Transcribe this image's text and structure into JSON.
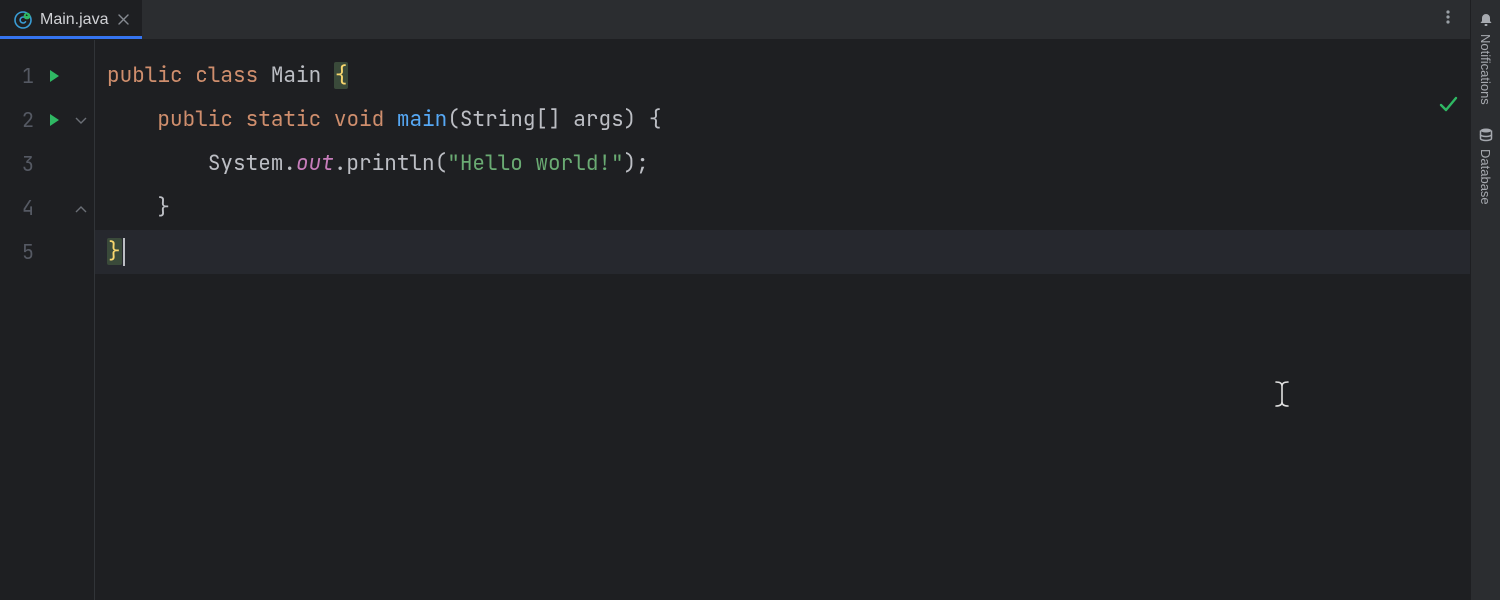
{
  "tab": {
    "filename": "Main.java",
    "active": true
  },
  "rightRail": {
    "notifications": "Notifications",
    "database": "Database"
  },
  "editor": {
    "currentLine": 5,
    "lines": [
      "1",
      "2",
      "3",
      "4",
      "5"
    ],
    "runOnLines": [
      1,
      2
    ],
    "code": {
      "l1": {
        "kw1": "public",
        "kw2": "class",
        "cls": "Main",
        "brace": "{"
      },
      "l2": {
        "kw1": "public",
        "kw2": "static",
        "kw3": "void",
        "method": "main",
        "sig": "(String[] args) {"
      },
      "l3": {
        "sysout": "System.",
        "out": "out",
        "print": ".println(",
        "str": "\"Hello world!\"",
        "end": ");"
      },
      "l4": {
        "brace": "}"
      },
      "l5": {
        "brace": "}"
      }
    }
  }
}
